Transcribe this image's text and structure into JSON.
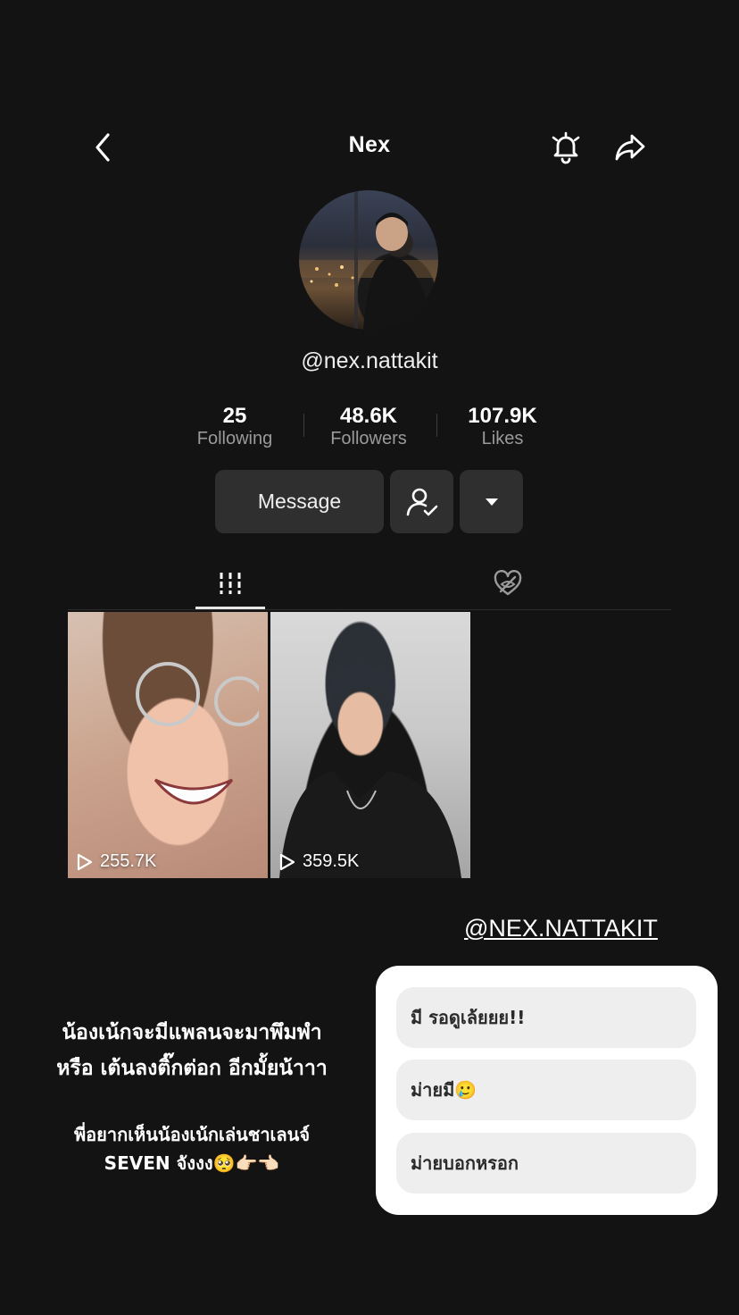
{
  "header": {
    "title": "Nex"
  },
  "profile": {
    "username": "@nex.nattakit"
  },
  "stats": [
    {
      "value": "25",
      "label": "Following"
    },
    {
      "value": "48.6K",
      "label": "Followers"
    },
    {
      "value": "107.9K",
      "label": "Likes"
    }
  ],
  "actions": {
    "message_label": "Message"
  },
  "videos": [
    {
      "views": "255.7K"
    },
    {
      "views": "359.5K"
    }
  ],
  "story": {
    "mention": "@NEX.NATTAKIT",
    "question_line1": "น้องเน้กจะมีแพลนจะมาพึมพำ",
    "question_line2": "หรือ เต้นลงติ๊กต่อก อีกมั้ยน้าาา",
    "wish_line1": "พี่อยากเห็นน้องเน้กเล่นชาเลนจ์",
    "wish_line2": "SEVEN จังงง🥺👉🏻👈🏻"
  },
  "poll": {
    "options": [
      "มี รอดูเล้ยยย!!",
      "ม่ายมี🥲",
      "ม่ายบอกหรอก"
    ]
  }
}
